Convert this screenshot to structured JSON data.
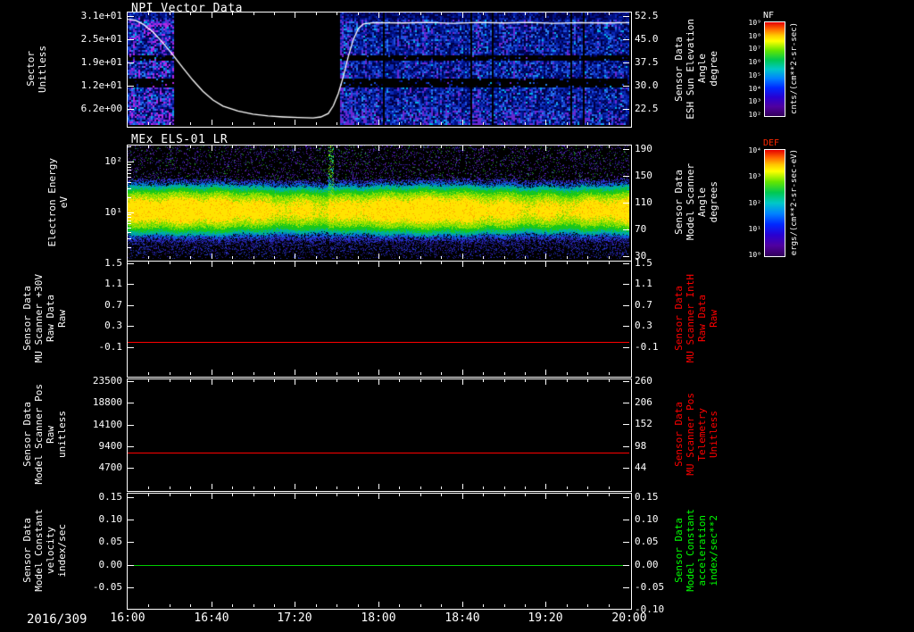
{
  "meta": {
    "background": "#000000",
    "description": "Multi-panel spacecraft sensor time-series plot (NPI / MEx ELS)"
  },
  "time_axis": {
    "date": "2016/309",
    "start": "16:00",
    "end": "20:00",
    "ticks": [
      "16:00",
      "16:40",
      "17:20",
      "18:00",
      "18:40",
      "19:20",
      "20:00"
    ]
  },
  "chart_data": [
    {
      "type": "heatmap",
      "title": "NPI Vector Data",
      "ylabel_lines": [
        "Sector",
        "Unitless"
      ],
      "yscale": "linear",
      "ylim": [
        1.9,
        32.2
      ],
      "ytick_labels": [
        "3.1e+01",
        "2.5e+01",
        "1.9e+01",
        "1.2e+01",
        "6.2e+00"
      ],
      "ytick_values": [
        31.25,
        25,
        18.75,
        12.5,
        6.25
      ],
      "right_axis": {
        "label_lines": [
          "Sensor Data",
          "ESH Sun Elevation",
          "Angle",
          "degree"
        ],
        "label_color": "#ffffff",
        "ylim": [
          17.3,
          53.7
        ],
        "tick_labels": [
          "52.5",
          "45.0",
          "37.5",
          "30.0",
          "22.5"
        ],
        "tick_values": [
          52.5,
          45.0,
          37.5,
          30.0,
          22.5
        ]
      },
      "colorbar": {
        "title": "NF",
        "title_color": "#ffffff",
        "tick_labels": [
          "10⁹",
          "10⁸",
          "10⁷",
          "10⁶",
          "10⁵",
          "10⁴",
          "10³",
          "10²"
        ],
        "units": "cnts/(cm**2-sr-sec)"
      },
      "heatmap": {
        "z_quantity": "NPI sector count rate",
        "appearance": "blue/violet noise across all sectors",
        "data_gap_x_frac": [
          0.093,
          0.422
        ],
        "dark_sector_bands_y_frac": [
          [
            0.38,
            0.42
          ],
          [
            0.587,
            0.651
          ]
        ]
      },
      "overlay_line": {
        "name": "ESH Sun Elevation Angle (degree)",
        "color": "#ffffff",
        "axis": "right",
        "x_frac": [
          0,
          0.015,
          0.03,
          0.05,
          0.07,
          0.09,
          0.11,
          0.13,
          0.15,
          0.17,
          0.19,
          0.22,
          0.25,
          0.28,
          0.31,
          0.34,
          0.37,
          0.385,
          0.4,
          0.41,
          0.42,
          0.43,
          0.44,
          0.45,
          0.46,
          0.47,
          0.49,
          0.55,
          0.6,
          0.65,
          0.7,
          0.75,
          0.8,
          0.85,
          0.9,
          0.95,
          1.0
        ],
        "values": [
          51.5,
          51.2,
          50.0,
          47.5,
          44.0,
          40.0,
          35.8,
          31.8,
          28.2,
          25.4,
          23.4,
          21.8,
          20.8,
          20.2,
          19.9,
          19.7,
          19.6,
          19.9,
          21.0,
          23.5,
          27.5,
          33.0,
          39.5,
          45.0,
          48.5,
          50.0,
          50.4,
          50.3,
          50.5,
          50.2,
          50.5,
          50.3,
          50.5,
          50.2,
          50.4,
          50.3,
          50.4
        ]
      }
    },
    {
      "type": "heatmap",
      "title": "MEx ELS-01 LR",
      "ylabel_lines": [
        "Electron Energy",
        "eV"
      ],
      "yscale": "log",
      "ylim": [
        1.2,
        210
      ],
      "ytick_labels": [
        "10²",
        "10¹"
      ],
      "ytick_values": [
        100,
        10
      ],
      "right_axis": {
        "label_lines": [
          "Sensor Data",
          "Model Scanner",
          "Angle",
          "degrees"
        ],
        "label_color": "#ffffff",
        "ylim": [
          26,
          195
        ],
        "tick_labels": [
          "190",
          "150",
          "110",
          "70",
          "30"
        ],
        "tick_values": [
          190,
          150,
          110,
          70,
          30
        ]
      },
      "colorbar": {
        "title": "DEF",
        "title_color": "#ff2800",
        "tick_labels": [
          "10⁴",
          "10³",
          "10²",
          "10¹",
          "10⁰"
        ],
        "units": "ergs/(cm**2-sr-sec-eV)"
      },
      "heatmap": {
        "z_quantity": "electron differential energy flux",
        "appearance": "intense yellow band ~6-20 eV with green edges fading to blue below 4 eV; sparse violet noise above",
        "band_core_eV": [
          6.5,
          18.5
        ],
        "disturbance_x_frac": 0.405
      }
    },
    {
      "type": "line",
      "title": "",
      "ylabel_lines": [
        "Sensor Data",
        "MU Scanner +30V",
        "Raw Data",
        "Raw"
      ],
      "yscale": "linear",
      "ylim": [
        -0.63,
        1.53
      ],
      "ytick_labels": [
        "1.5",
        "1.1",
        "0.7",
        "0.3",
        "-0.1"
      ],
      "ytick_values": [
        1.5,
        1.1,
        0.7,
        0.3,
        -0.1
      ],
      "right_axis": {
        "label_lines": [
          "Sensor Data",
          "MU Scanner IntH",
          "Raw Data",
          "Raw"
        ],
        "label_color": "#ff0000",
        "ylim": [
          -0.63,
          1.53
        ],
        "tick_labels": [
          "1.5",
          "1.1",
          "0.7",
          "0.3",
          "-0.1"
        ],
        "tick_values": [
          1.5,
          1.1,
          0.7,
          0.3,
          -0.1
        ]
      },
      "series": [
        {
          "name": "MU Scanner +30V Raw Data",
          "color": "#ff0000",
          "constant_value": 0.0
        }
      ]
    },
    {
      "type": "line",
      "title": "",
      "ylabel_lines": [
        "Sensor Data",
        "Model Scanner Pos",
        "Raw",
        "unitless"
      ],
      "yscale": "linear",
      "ylim": [
        60,
        23890
      ],
      "ytick_labels": [
        "23500",
        "18800",
        "14100",
        "9400",
        "4700"
      ],
      "ytick_values": [
        23500,
        18800,
        14100,
        9400,
        4700
      ],
      "right_axis": {
        "label_lines": [
          "Sensor Data",
          "MU Scanner Pos",
          "Telemetry",
          "Unitless"
        ],
        "label_color": "#ff0000",
        "ylim": [
          -9,
          264
        ],
        "tick_labels": [
          "260",
          "206",
          "152",
          "98",
          "44"
        ],
        "tick_values": [
          260,
          206,
          152,
          98,
          44
        ]
      },
      "series": [
        {
          "name": "Model Scanner Pos Raw",
          "color": "#ff0000",
          "constant_value": 8100
        }
      ]
    },
    {
      "type": "line",
      "title": "",
      "ylabel_lines": [
        "Sensor Data",
        "Model Constant",
        "velocity",
        "index/sec"
      ],
      "yscale": "linear",
      "ylim": [
        -0.094,
        0.158
      ],
      "ytick_labels": [
        "0.15",
        "0.10",
        "0.05",
        "0.00",
        "-0.05"
      ],
      "ytick_values": [
        0.15,
        0.1,
        0.05,
        0.0,
        -0.05
      ],
      "right_axis": {
        "label_lines": [
          "Sensor Data",
          "Model Constant",
          "acceleration",
          "index/sec**2"
        ],
        "label_color": "#00ff00",
        "ylim": [
          -0.094,
          0.158
        ],
        "tick_labels": [
          "0.15",
          "0.10",
          "0.05",
          "0.00",
          "-0.05",
          "-0.10"
        ],
        "tick_values": [
          0.15,
          0.1,
          0.05,
          0.0,
          -0.05,
          -0.1
        ]
      },
      "series": [
        {
          "name": "Model Constant velocity",
          "color": "#00cc00",
          "constant_value": 0.0
        }
      ]
    }
  ]
}
